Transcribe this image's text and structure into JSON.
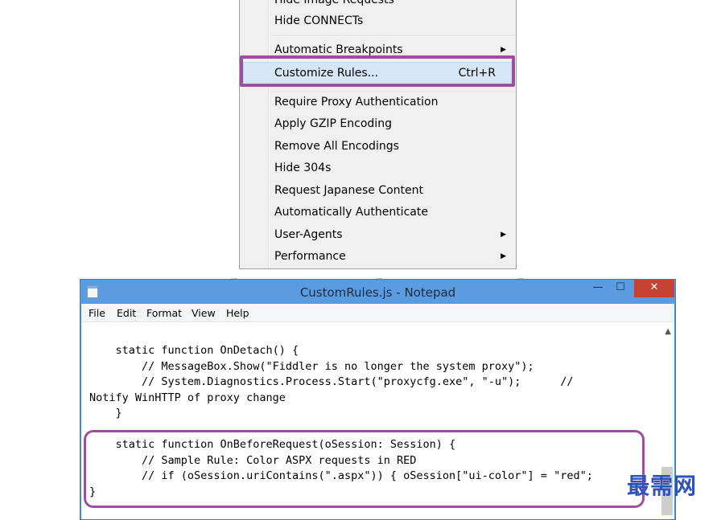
{
  "context_menu": {
    "items": [
      {
        "label": "Hide Image Requests",
        "arrow": ""
      },
      {
        "label": "Hide CONNECTs",
        "arrow": ""
      },
      {
        "label": "Automatic Breakpoints",
        "arrow": "▶"
      },
      {
        "label": "Customize Rules...",
        "shortcut": "Ctrl+R"
      },
      {
        "label": "Require Proxy Authentication"
      },
      {
        "label": "Apply GZIP Encoding"
      },
      {
        "label": "Remove All Encodings"
      },
      {
        "label": "Hide 304s"
      },
      {
        "label": "Request Japanese Content"
      },
      {
        "label": "Automatically Authenticate"
      },
      {
        "label": "User-Agents",
        "arrow": "▶"
      },
      {
        "label": "Performance",
        "arrow": "▶"
      }
    ],
    "highlight_color": "#9b4f9e"
  },
  "notepad": {
    "title": "CustomRules.js - Notepad",
    "controls": {
      "minimize": "—",
      "maximize": "☐",
      "close": "✕"
    },
    "menu": [
      "File",
      "Edit",
      "Format",
      "View",
      "Help"
    ],
    "code_top": "    static function OnDetach() {\n        // MessageBox.Show(\"Fiddler is no longer the system proxy\");\n        // System.Diagnostics.Process.Start(\"proxycfg.exe\", \"-u\");      //\nNotify WinHTTP of proxy change\n    }",
    "code_bottom": "    static function OnBeforeRequest(oSession: Session) {\n        // Sample Rule: Color ASPX requests in RED\n        // if (oSession.uriContains(\".aspx\")) { oSession[\"ui-color\"] = \"red\";\n}",
    "scroll_up_icon": "chevron-up-icon"
  },
  "watermark": "最需网"
}
